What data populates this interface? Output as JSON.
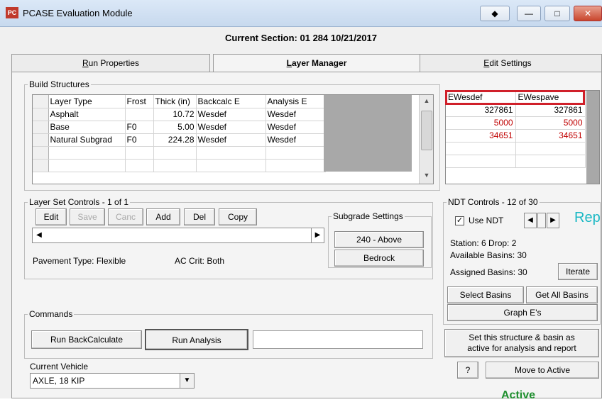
{
  "window": {
    "title": "PCASE Evaluation Module",
    "app_icon_text": "PC",
    "buttons": {
      "special": "◆",
      "minimize": "—",
      "maximize": "□",
      "close": "✕"
    }
  },
  "section": "Current Section: 01 284 10/21/2017",
  "tabs": [
    {
      "label": "Run Properties",
      "mnemonic": "R",
      "rest": "un Properties"
    },
    {
      "label": "Layer Manager",
      "mnemonic": "L",
      "rest": "ayer Manager"
    },
    {
      "label": "Edit Settings",
      "mnemonic": "E",
      "rest": "dit Settings"
    }
  ],
  "build_structures": {
    "legend": "Build Structures",
    "columns": [
      "Layer Type",
      "Frost",
      "Thick (in)",
      "Backcalc E",
      "Analysis E"
    ],
    "rows": [
      [
        "Asphalt",
        "",
        "10.72",
        "Wesdef",
        "Wesdef"
      ],
      [
        "Base",
        "F0",
        "5.00",
        "Wesdef",
        "Wesdef"
      ],
      [
        "Natural Subgrad",
        "F0",
        "224.28",
        "Wesdef",
        "Wesdef"
      ]
    ]
  },
  "e_grid": {
    "columns": [
      "EWesdef",
      "EWespave"
    ],
    "rows": [
      [
        "327861",
        "327861"
      ],
      [
        "5000",
        "5000"
      ],
      [
        "34651",
        "34651"
      ]
    ]
  },
  "layer_set": {
    "legend": "Layer Set Controls - 1 of 1",
    "buttons": [
      "Edit",
      "Save",
      "Canc",
      "Add",
      "Del",
      "Copy"
    ],
    "pavement_type": "Pavement Type: Flexible",
    "ac_crit": "AC Crit: Both"
  },
  "subgrade": {
    "legend": "Subgrade Settings",
    "above": "240 - Above",
    "bedrock": "Bedrock"
  },
  "ndt": {
    "legend": "NDT Controls - 12 of 30",
    "use_ndt": "Use NDT",
    "rep": "Rep",
    "station": "Station: 6 Drop: 2",
    "available": "Available Basins: 30",
    "assigned": "Assigned Basins: 30",
    "iterate": "Iterate",
    "select_basins": "Select Basins",
    "get_all": "Get All Basins",
    "graph": "Graph E's"
  },
  "commands": {
    "legend": "Commands",
    "backcalc": "Run BackCalculate",
    "analysis": "Run Analysis"
  },
  "set_active": {
    "text1": "Set this structure & basin as",
    "text2": "active for analysis and report",
    "help": "?",
    "move": "Move to Active",
    "status": "Active"
  },
  "vehicle": {
    "label": "Current Vehicle",
    "value": "AXLE, 18 KIP"
  }
}
